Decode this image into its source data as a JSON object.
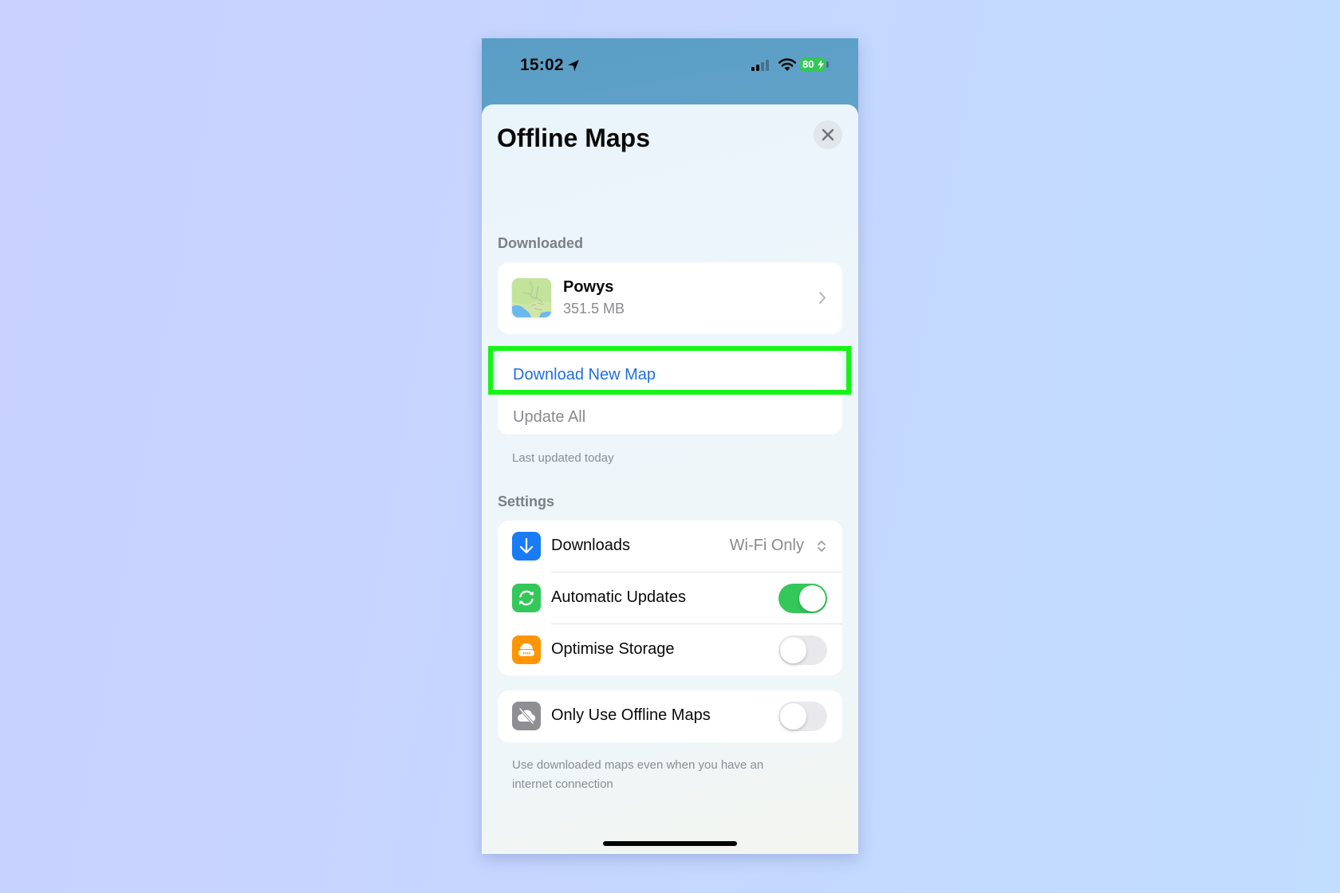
{
  "status_bar": {
    "time": "15:02",
    "location_icon": "location-arrow-icon",
    "signal_icon": "cellular-signal-icon",
    "wifi_icon": "wifi-icon",
    "battery_level": "80",
    "battery_charging": true
  },
  "sheet": {
    "title": "Offline Maps",
    "close_icon": "close-icon"
  },
  "downloaded": {
    "section_label": "Downloaded",
    "maps": [
      {
        "name": "Powys",
        "size": "351.5 MB"
      }
    ]
  },
  "actions": {
    "download_new_map": "Download New Map",
    "update_all": "Update All",
    "last_updated": "Last updated today"
  },
  "settings": {
    "section_label": "Settings",
    "downloads": {
      "label": "Downloads",
      "value": "Wi-Fi Only",
      "icon": "download-arrow-icon",
      "icon_color": "#1a7cf5"
    },
    "automatic_updates": {
      "label": "Automatic Updates",
      "enabled": true,
      "icon": "refresh-icon",
      "icon_color": "#34c759"
    },
    "optimise_storage": {
      "label": "Optimise Storage",
      "enabled": false,
      "icon": "storage-drive-icon",
      "icon_color": "#ff9500"
    },
    "only_offline": {
      "label": "Only Use Offline Maps",
      "enabled": false,
      "icon": "cloud-off-icon",
      "icon_color": "#8e8e93"
    },
    "only_offline_footnote_line1": "Use downloaded maps even when you have an",
    "only_offline_footnote_line2": "internet connection"
  },
  "colors": {
    "accent_blue": "#1f6fe0",
    "highlight_green": "#14f514",
    "toggle_on": "#34c759"
  }
}
